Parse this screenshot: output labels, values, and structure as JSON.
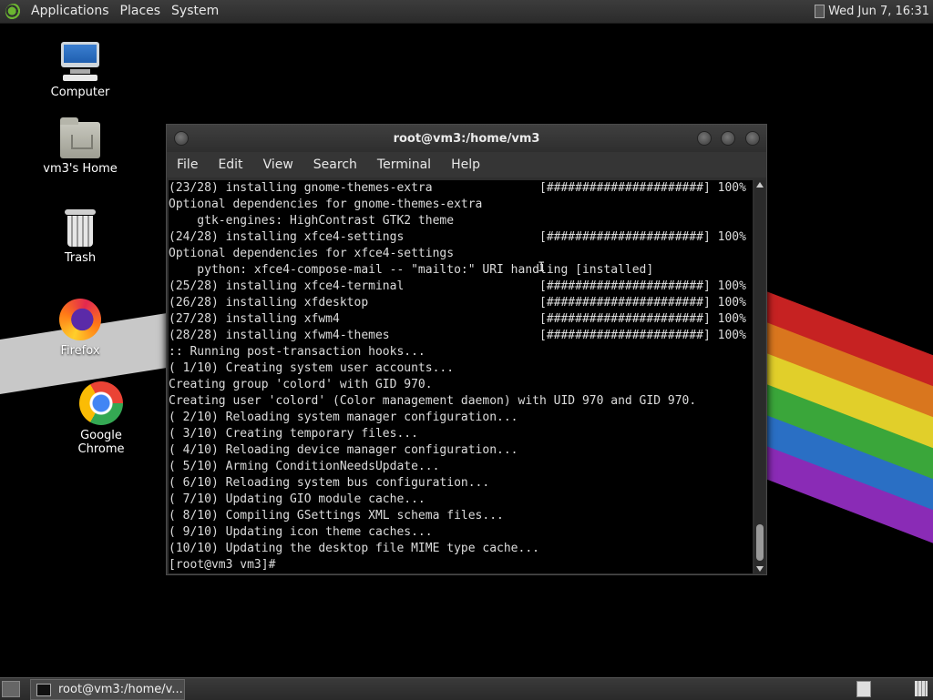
{
  "top_panel": {
    "menus": [
      "Applications",
      "Places",
      "System"
    ],
    "clock": "Wed Jun  7, 16:31"
  },
  "desktop": {
    "icons": [
      {
        "label": "Computer",
        "icon": "computer-icon"
      },
      {
        "label": "vm3's Home",
        "icon": "home-folder-icon"
      },
      {
        "label": "Trash",
        "icon": "trash-icon"
      },
      {
        "label": "Firefox",
        "icon": "firefox-icon"
      },
      {
        "label": "Google Chrome",
        "icon": "chrome-icon"
      }
    ]
  },
  "window": {
    "title": "root@vm3:/home/vm3",
    "menus": [
      "File",
      "Edit",
      "View",
      "Search",
      "Terminal",
      "Help"
    ],
    "lines": [
      "(23/28) installing gnome-themes-extra               [######################] 100%",
      "Optional dependencies for gnome-themes-extra",
      "    gtk-engines: HighContrast GTK2 theme",
      "(24/28) installing xfce4-settings                   [######################] 100%",
      "Optional dependencies for xfce4-settings",
      "    python: xfce4-compose-mail -- \"mailto:\" URI handling [installed]",
      "(25/28) installing xfce4-terminal                   [######################] 100%",
      "(26/28) installing xfdesktop                        [######################] 100%",
      "(27/28) installing xfwm4                            [######################] 100%",
      "(28/28) installing xfwm4-themes                     [######################] 100%",
      ":: Running post-transaction hooks...",
      "( 1/10) Creating system user accounts...",
      "Creating group 'colord' with GID 970.",
      "Creating user 'colord' (Color management daemon) with UID 970 and GID 970.",
      "( 2/10) Reloading system manager configuration...",
      "( 3/10) Creating temporary files...",
      "( 4/10) Reloading device manager configuration...",
      "( 5/10) Arming ConditionNeedsUpdate...",
      "( 6/10) Reloading system bus configuration...",
      "( 7/10) Updating GIO module cache...",
      "( 8/10) Compiling GSettings XML schema files...",
      "( 9/10) Updating icon theme caches...",
      "(10/10) Updating the desktop file MIME type cache...",
      "[root@vm3 vm3]# "
    ]
  },
  "bottom_panel": {
    "task_label": "root@vm3:/home/v..."
  },
  "colors": {
    "terminal_bg": "#000000",
    "terminal_fg": "#dcdcdc",
    "panel_bg": "#2f2f2f"
  }
}
